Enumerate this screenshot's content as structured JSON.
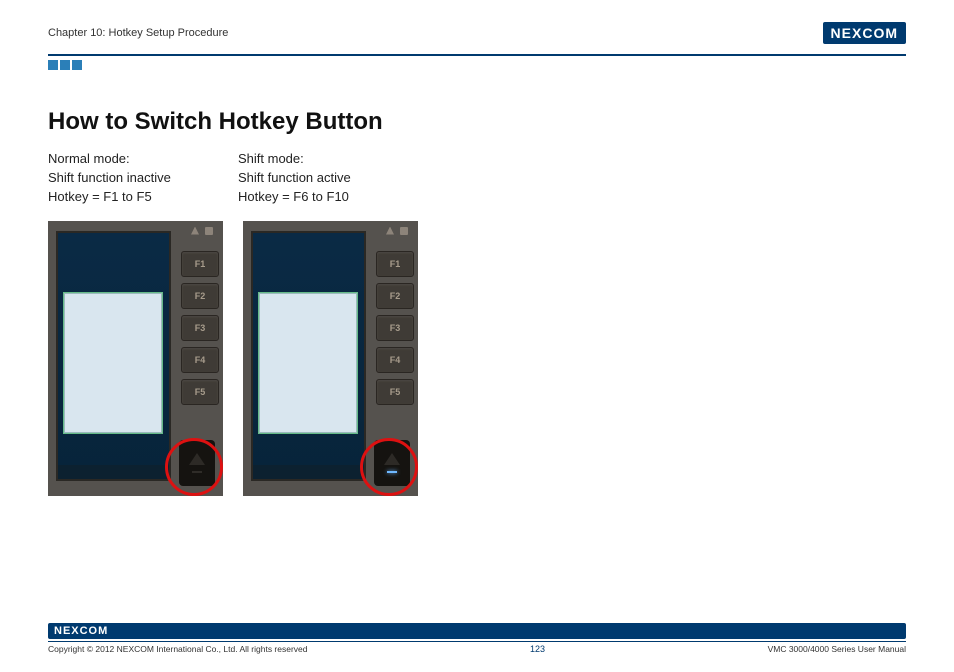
{
  "header": {
    "chapter": "Chapter 10: Hotkey Setup Procedure",
    "brand": "NEXCOM"
  },
  "title": "How to Switch Hotkey Button",
  "modes": [
    {
      "name": "Normal mode:",
      "line2": "Shift function inactive",
      "line3": "Hotkey = F1 to F5"
    },
    {
      "name": "Shift mode:",
      "line2": "Shift function active",
      "line3": "Hotkey = F6 to F10"
    }
  ],
  "buttons": [
    "F1",
    "F2",
    "F3",
    "F4",
    "F5"
  ],
  "footer": {
    "brand": "NEXCOM",
    "copyright": "Copyright © 2012 NEXCOM International Co., Ltd. All rights reserved",
    "page": "123",
    "manual": "VMC 3000/4000 Series User Manual"
  }
}
